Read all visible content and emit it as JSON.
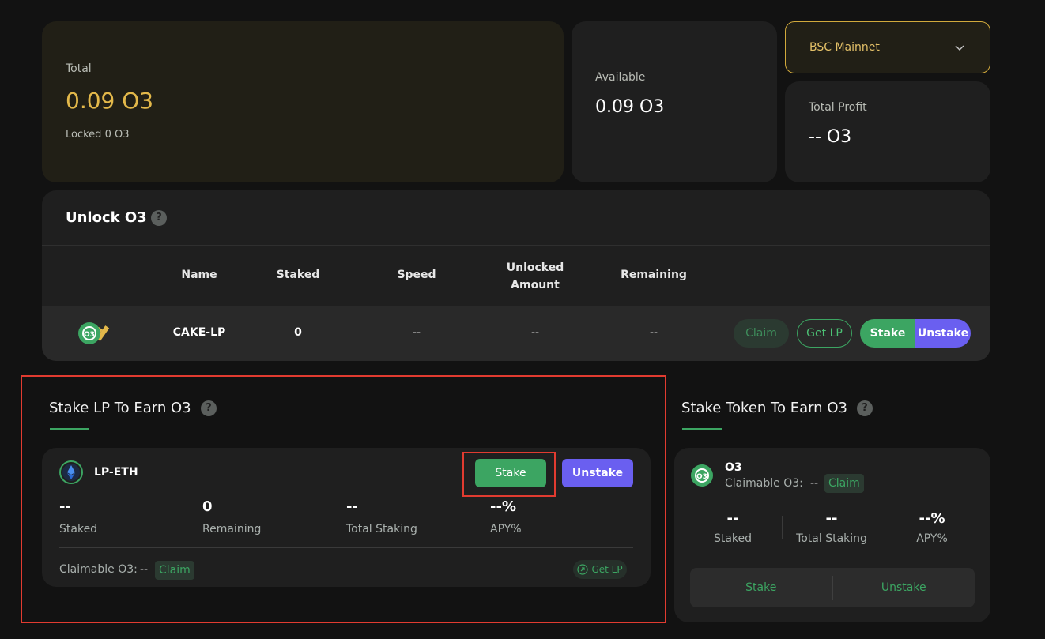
{
  "summary": {
    "total_label": "Total",
    "total_value": "0.09 O3",
    "locked_text": "Locked 0 O3",
    "available_label": "Available",
    "available_value": "0.09 O3",
    "profit_label": "Total Profit",
    "profit_value": "-- O3",
    "network": "BSC Mainnet"
  },
  "unlock": {
    "title": "Unlock O3",
    "columns": [
      "Name",
      "Staked",
      "Speed",
      "Unlocked Amount",
      "Remaining"
    ],
    "row": {
      "name": "CAKE-LP",
      "staked": "0",
      "speed": "--",
      "unlocked_amount": "--",
      "remaining": "--"
    },
    "buttons": {
      "claim": "Claim",
      "get_lp": "Get LP",
      "stake": "Stake",
      "unstake": "Unstake"
    }
  },
  "stake_lp": {
    "title": "Stake LP To Earn O3",
    "token": "LP-ETH",
    "stake_label": "Stake",
    "unstake_label": "Unstake",
    "stats": [
      {
        "value": "--",
        "label": "Staked"
      },
      {
        "value": "0",
        "label": "Remaining"
      },
      {
        "value": "--",
        "label": "Total Staking"
      },
      {
        "value": "--%",
        "label": "APY%"
      }
    ],
    "claimable_label": "Claimable O3:",
    "claimable_value": "--",
    "claim_label": "Claim",
    "get_lp_label": "Get LP"
  },
  "stake_token": {
    "title": "Stake Token To Earn O3",
    "token": "O3",
    "claimable_label": "Claimable O3:",
    "claimable_value": "--",
    "claim_label": "Claim",
    "stats": [
      {
        "value": "--",
        "label": "Staked"
      },
      {
        "value": "--",
        "label": "Total Staking"
      },
      {
        "value": "--%",
        "label": "APY%"
      }
    ],
    "stake_label": "Stake",
    "unstake_label": "Unstake"
  },
  "colors": {
    "accent_green": "#3ca562",
    "accent_purple": "#6a5ff0",
    "gold": "#e3b84a",
    "highlight_red": "#e13b30"
  },
  "icons": [
    "chevron-down-icon",
    "help-icon",
    "o3-token-icon",
    "eth-lp-icon",
    "external-link-icon"
  ]
}
